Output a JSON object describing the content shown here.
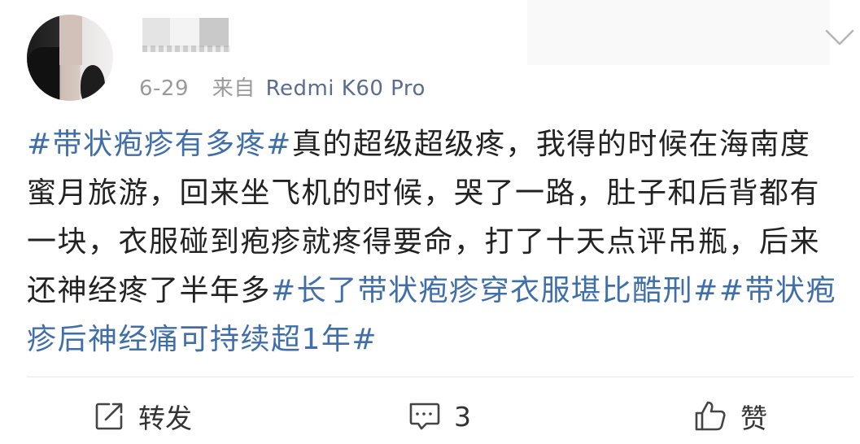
{
  "post": {
    "date": "6-29",
    "source_prefix": "来自",
    "device": "Redmi K60 Pro",
    "content": [
      {
        "type": "tag",
        "text": "#带状疱疹有多疼#"
      },
      {
        "type": "text",
        "text": "真的超级超级疼，我得的时候在海南度蜜月旅游，回来坐飞机的时候，哭了一路，肚子和后背都有一块，衣服碰到疱疹就疼得要命，打了十天点评吊瓶，后来还神经疼了半年多"
      },
      {
        "type": "tag",
        "text": "#长了带状疱疹穿衣服堪比酷刑#"
      },
      {
        "type": "tag",
        "text": "#带状疱疹后神经痛可持续超1年#"
      }
    ]
  },
  "actions": {
    "repost_label": "转发",
    "comment_count": "3",
    "like_label": "赞"
  },
  "icons": {
    "repost": "share-box-icon",
    "comment": "comment-bubble-icon",
    "like": "thumbs-up-icon",
    "menu": "chevron-down-icon"
  },
  "colors": {
    "tag": "#3f6ea8",
    "device": "#5a6d8f",
    "meta": "#9a9a9a",
    "text": "#222222"
  }
}
